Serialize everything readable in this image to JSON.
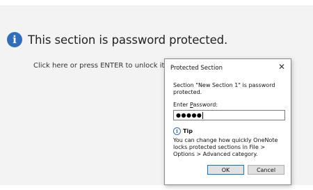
{
  "section": {
    "header_text": "This section is password protected.",
    "unlock_text": "Click here or press ENTER to unlock it.",
    "info_icon_glyph": "i"
  },
  "dialog": {
    "title": "Protected Section",
    "close_glyph": "✕",
    "message": "Section \"New Section 1\" is password protected.",
    "password_label_pre": "Enter ",
    "password_label_accel": "P",
    "password_label_post": "assword:",
    "password_value": "●●●●●",
    "tip_icon_glyph": "i",
    "tip_title": "Tip",
    "tip_text": "You can change how quickly OneNote locks protected sections in File > Options > Advanced category.",
    "ok_label": "OK",
    "cancel_label": "Cancel"
  },
  "icons": {
    "section_info": "info-icon",
    "tip_info": "info-icon",
    "close": "close-icon"
  },
  "colors": {
    "accent": "#2f6dbd",
    "ok_border": "#0078d7",
    "background": "#f3f3f3"
  }
}
